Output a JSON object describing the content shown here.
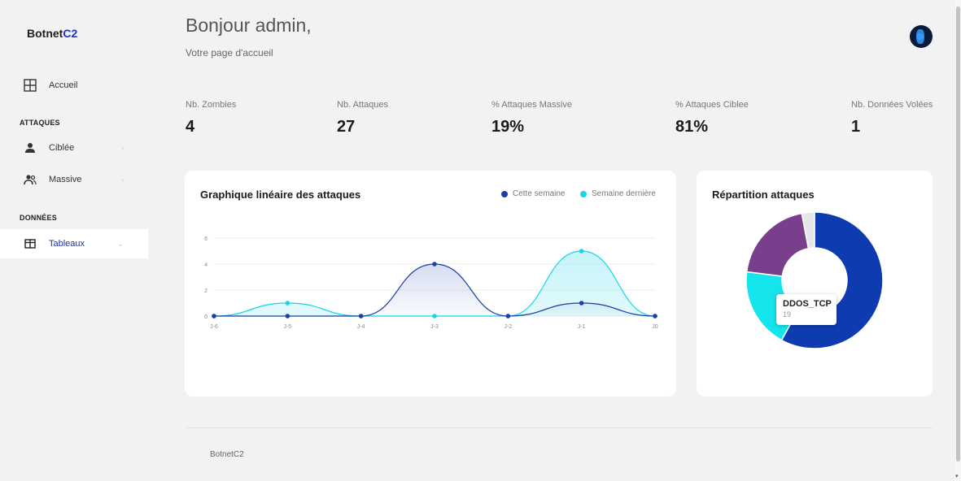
{
  "sidebar": {
    "brand_main": "Botnet",
    "brand_accent": "C2",
    "home": "Accueil",
    "section_attacks": "ATTAQUES",
    "item_ciblee": "Ciblée",
    "item_massive": "Massive",
    "section_data": "DONNÉES",
    "item_tables": "Tableaux",
    "caret_right": "›",
    "caret_down": "⌄"
  },
  "header": {
    "greeting": "Bonjour admin,",
    "subtitle": "Votre page d'accueil"
  },
  "stats": [
    {
      "label": "Nb. Zombies",
      "value": "4"
    },
    {
      "label": "Nb. Attaques",
      "value": "27"
    },
    {
      "label": "% Attaques Massive",
      "value": "19%"
    },
    {
      "label": "% Attaques Ciblee",
      "value": "81%"
    },
    {
      "label": "Nb. Données Volées",
      "value": "1"
    }
  ],
  "line_card": {
    "title": "Graphique linéaire des attaques",
    "legend_this_week": "Cette semaine",
    "legend_last_week": "Semaine dernière"
  },
  "donut_card": {
    "title": "Répartition attaques",
    "tooltip_label": "DDOS_TCP",
    "tooltip_value": "19"
  },
  "footer": {
    "text": "BotnetC2"
  },
  "colors": {
    "this_week": "#1a3fa8",
    "last_week": "#17d4e8",
    "donut_blue": "#0f3bb0",
    "donut_cyan": "#14e4ec",
    "donut_purple": "#7a3f8c",
    "donut_grey": "#e6e6e6"
  },
  "chart_data": [
    {
      "type": "line",
      "title": "Graphique linéaire des attaques",
      "categories": [
        "J-6",
        "J-5",
        "J-4",
        "J-3",
        "J-2",
        "J-1",
        "J0"
      ],
      "y_ticks": [
        "0",
        "2",
        "4",
        "6"
      ],
      "ylim": [
        0,
        6
      ],
      "grid": true,
      "legend_position": "top-right",
      "series": [
        {
          "name": "Cette semaine",
          "values": [
            0,
            0,
            0,
            4,
            0,
            1,
            0
          ]
        },
        {
          "name": "Semaine dernière",
          "values": [
            0,
            1,
            0,
            0,
            0,
            5,
            0
          ]
        }
      ]
    },
    {
      "type": "pie",
      "title": "Répartition attaques",
      "values": [
        58,
        19,
        20,
        3
      ],
      "highlighted_label": "DDOS_TCP"
    }
  ]
}
